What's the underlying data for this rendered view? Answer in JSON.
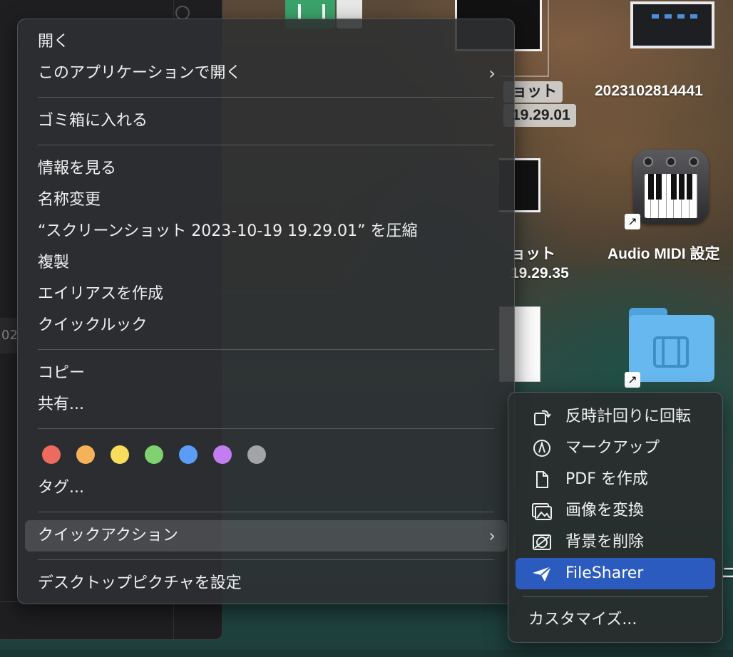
{
  "desktop": {
    "labels": {
      "shot1_line1": "ョット",
      "shot1_line2": "19.29.01",
      "shot2_line1": "ョット",
      "shot2_line2": "19.29.35",
      "screenshot_file": "2023102814441",
      "app_name": "Audio MIDI 設定",
      "partial_right": "ニ",
      "left_peek": "02"
    }
  },
  "context_menu": {
    "open": "開く",
    "open_with": "このアプリケーションで開く",
    "trash": "ゴミ箱に入れる",
    "get_info": "情報を見る",
    "rename": "名称変更",
    "compress": "“スクリーンショット 2023-10-19 19.29.01” を圧縮",
    "duplicate": "複製",
    "make_alias": "エイリアスを作成",
    "quick_look": "クイックルック",
    "copy": "コピー",
    "share": "共有...",
    "tags_label": "タグ...",
    "tag_colors": [
      "#ec6a5e",
      "#f5b25a",
      "#f9dc5c",
      "#7fd26f",
      "#5b9cf6",
      "#c27df0",
      "#a4a4a6"
    ],
    "tag_names": [
      "red-tag",
      "orange-tag",
      "yellow-tag",
      "green-tag",
      "blue-tag",
      "purple-tag",
      "gray-tag"
    ],
    "quick_actions": "クイックアクション",
    "set_desktop_picture": "デスクトップピクチャを設定",
    "chevron": "›"
  },
  "quick_actions_menu": {
    "rotate_left": "反時計回りに回転",
    "markup": "マークアップ",
    "create_pdf": "PDF を作成",
    "convert_image": "画像を変換",
    "remove_background": "背景を削除",
    "filesharer": "FileSharer",
    "customize": "カスタマイズ...",
    "active_color": "#2c5bc0"
  }
}
